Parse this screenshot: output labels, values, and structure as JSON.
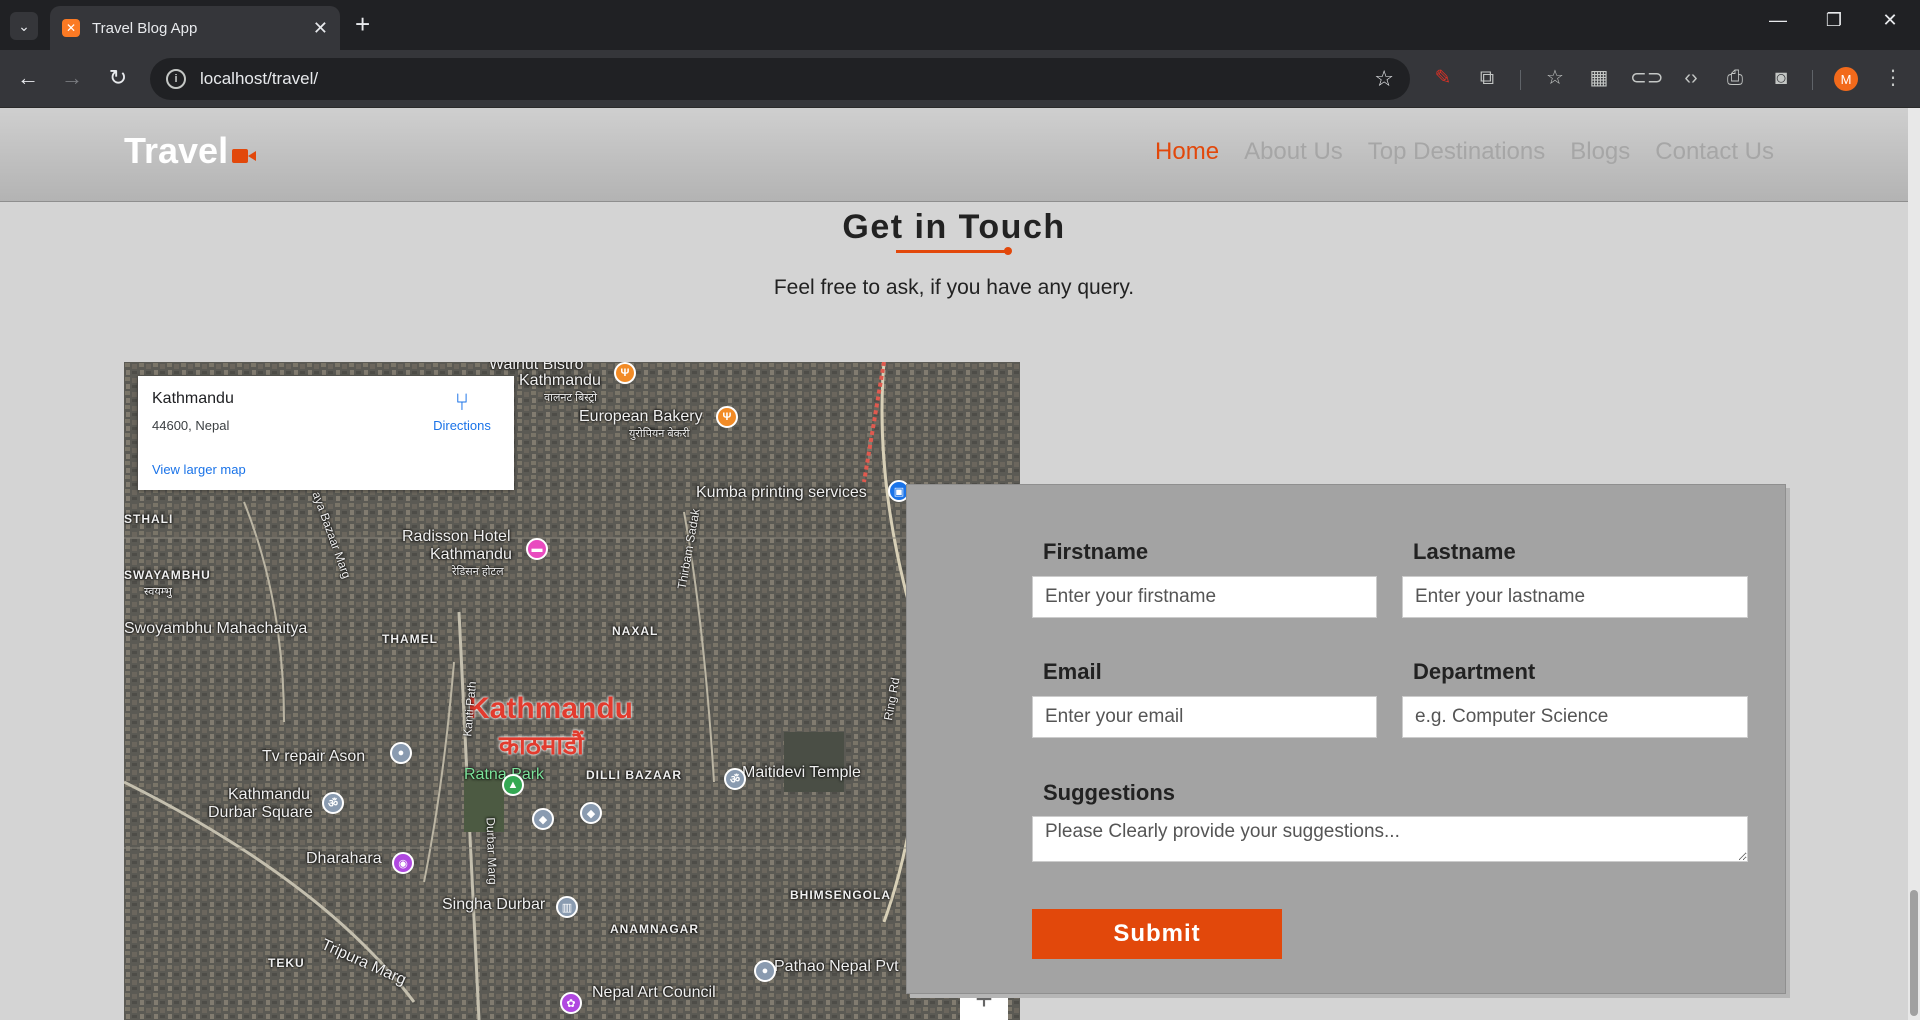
{
  "browser": {
    "tab_title": "Travel Blog App",
    "url": "localhost/travel/",
    "profile_initial": "M"
  },
  "site": {
    "logo_text": "Travel",
    "nav": [
      {
        "label": "Home",
        "active": true
      },
      {
        "label": "About Us",
        "active": false
      },
      {
        "label": "Top Destinations",
        "active": false
      },
      {
        "label": "Blogs",
        "active": false
      },
      {
        "label": "Contact Us",
        "active": false
      }
    ],
    "accent_color": "#e2480b"
  },
  "contact": {
    "heading": "Get in Touch",
    "subheading": "Feel free to ask, if you have any query."
  },
  "map": {
    "card": {
      "title": "Kathmandu",
      "address": "44600, Nepal",
      "directions_label": "Directions",
      "larger_map_link": "View larger map"
    },
    "labels": {
      "walnut_bistro": "Walnut Bistro",
      "kathmandu_en": "Kathmandu",
      "kathmandu_ne_small": "वालनट बिस्ट्रो",
      "european_bakery": "European Bakery",
      "european_bakery_ne": "युरोपियन बेकरी",
      "kumba": "Kumba printing services",
      "thali": "STHALI",
      "swayambhu": "SWAYAMBHU",
      "swayambhu_ne": "स्वयम्भु",
      "radisson": "Radisson Hotel",
      "radisson_kathmandu": "Kathmandu",
      "radisson_ne": "रेडिसन होटल",
      "mahachaitya": "Swoyambhu Mahachaitya",
      "thamel": "THAMEL",
      "naxal": "NAXAL",
      "city": "Kathmandu",
      "city_ne": "काठमाडौं",
      "tv_repair": "Tv repair Ason",
      "ratna_park": "Ratna Park",
      "dilli_bazaar": "DILLI BAZAAR",
      "maitidevi": "Maitidevi Temple",
      "durbar_square": "Kathmandu",
      "durbar_square_2": "Durbar Square",
      "dharahara": "Dharahara",
      "singha_durbar": "Singha Durbar",
      "bhimsengola": "BHIMSENGOLA",
      "anamnagar": "ANAMNAGAR",
      "teku": "TEKU",
      "tripura_marg": "Tripura Marg",
      "pathao": "Pathao Nepal Pvt",
      "nepal_art": "Nepal Art Council",
      "thirbam_sadak": "Thirbam Sadak",
      "ring_rd": "Ring Rd",
      "kanti_path": "Kanti Path",
      "durbar_marg": "Durbar Marg",
      "bazaar_marg": "aya Bazaar Marg"
    },
    "zoom_in": "+"
  },
  "form": {
    "firstname_label": "Firstname",
    "firstname_placeholder": "Enter your firstname",
    "lastname_label": "Lastname",
    "lastname_placeholder": "Enter your lastname",
    "email_label": "Email",
    "email_placeholder": "Enter your email",
    "department_label": "Department",
    "department_placeholder": "e.g. Computer Science",
    "suggestions_label": "Suggestions",
    "suggestions_placeholder": "Please Clearly provide your suggestions...",
    "submit_label": "Submit"
  }
}
